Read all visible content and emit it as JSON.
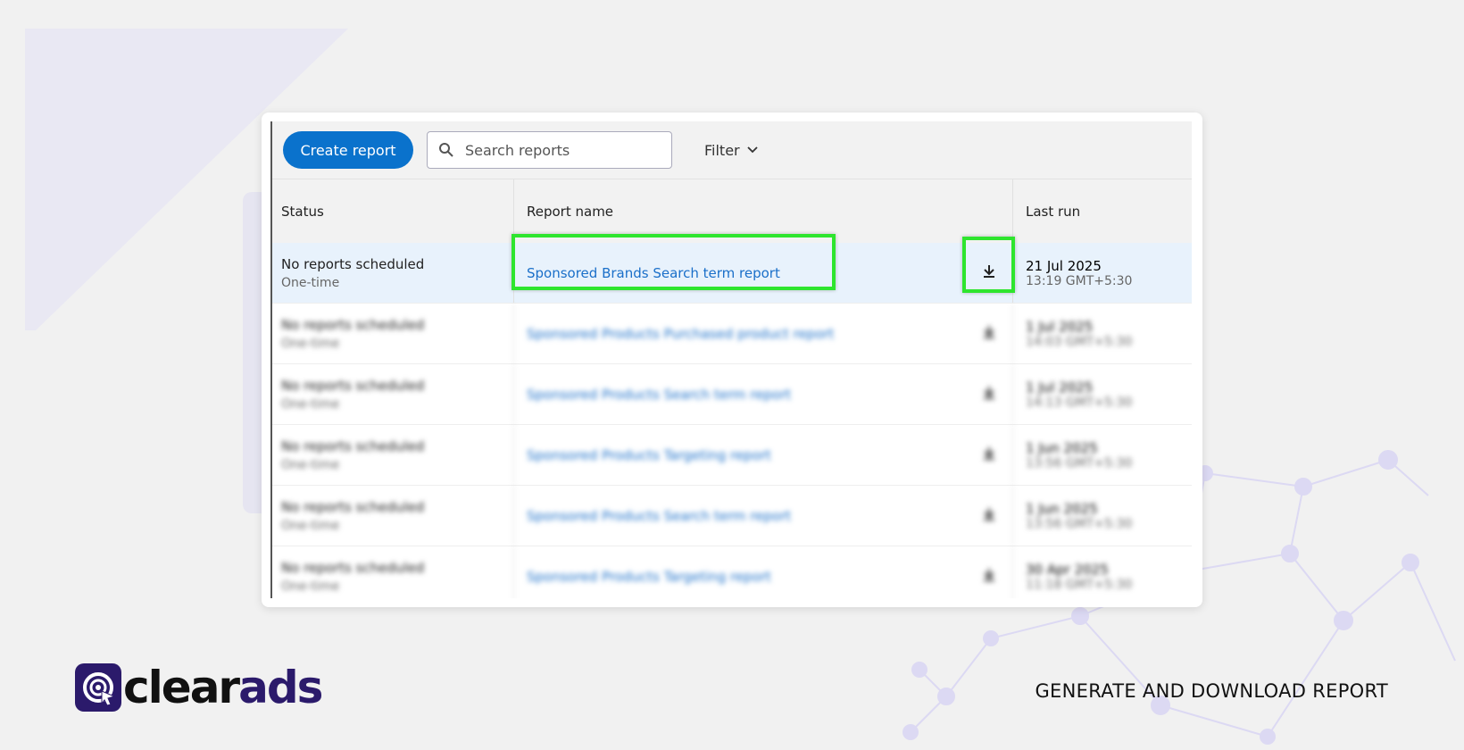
{
  "toolbar": {
    "create_label": "Create report",
    "search_placeholder": "Search reports",
    "filter_label": "Filter"
  },
  "table": {
    "headers": [
      "Status",
      "Report name",
      "Last run"
    ],
    "rows": [
      {
        "status": "No reports scheduled",
        "frequency": "One-time",
        "name": "Sponsored Brands Search term report",
        "date": "21 Jul 2025",
        "time": "13:19 GMT+5:30",
        "selected": true
      },
      {
        "status": "No reports scheduled",
        "frequency": "One-time",
        "name": "Sponsored Products Purchased product report",
        "date": "1 Jul 2025",
        "time": "14:03 GMT+5:30",
        "blurred": true
      },
      {
        "status": "No reports scheduled",
        "frequency": "One-time",
        "name": "Sponsored Products Search term report",
        "date": "1 Jul 2025",
        "time": "14:13 GMT+5:30",
        "blurred": true
      },
      {
        "status": "No reports scheduled",
        "frequency": "One-time",
        "name": "Sponsored Products Targeting report",
        "date": "1 Jun 2025",
        "time": "13:56 GMT+5:30",
        "blurred": true
      },
      {
        "status": "No reports scheduled",
        "frequency": "One-time",
        "name": "Sponsored Products Search term report",
        "date": "1 Jun 2025",
        "time": "13:56 GMT+5:30",
        "blurred": true
      },
      {
        "status": "No reports scheduled",
        "frequency": "One-time",
        "name": "Sponsored Products Targeting report",
        "date": "30 Apr 2025",
        "time": "11:18 GMT+5:30",
        "blurred": true
      }
    ]
  },
  "brand": {
    "logo_text": "clearads",
    "tagline": "GENERATE AND DOWNLOAD REPORT"
  },
  "colors": {
    "primary": "#0a72cc",
    "highlight": "#2ee52e",
    "brand": "#2b1a6b",
    "link": "#1a6fc9"
  }
}
